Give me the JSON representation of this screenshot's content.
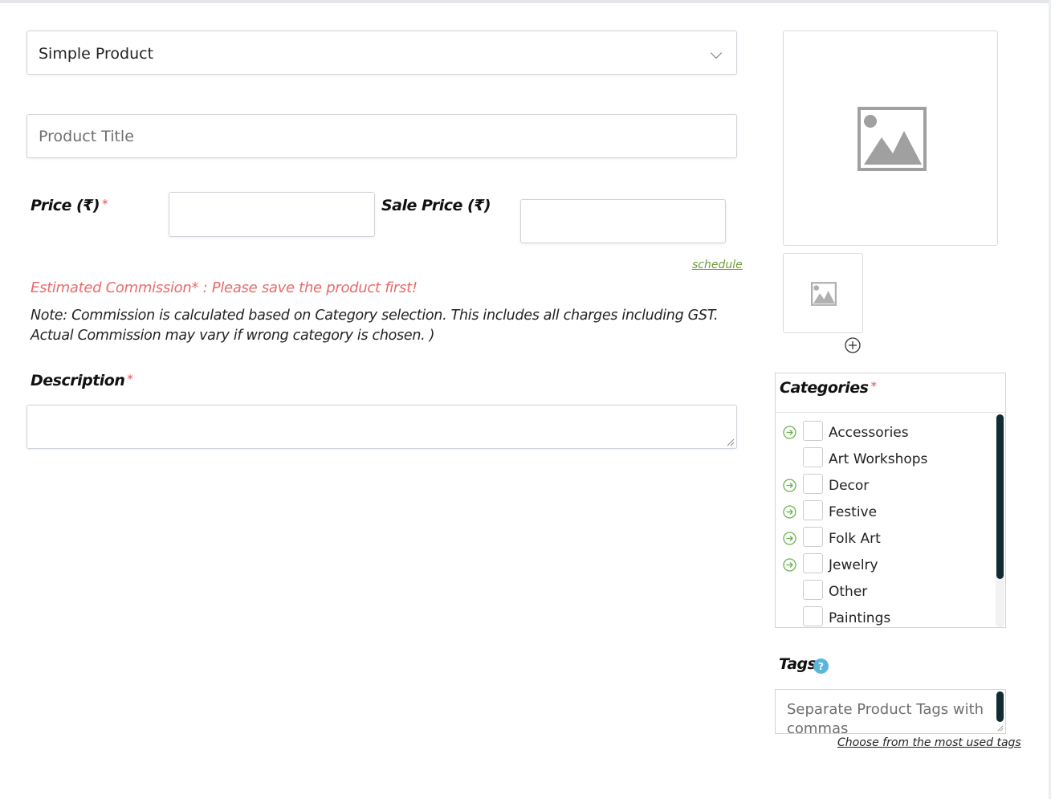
{
  "product_type": {
    "selected": "Simple Product"
  },
  "title": {
    "placeholder": "Product Title"
  },
  "price": {
    "label": "Price (₹)",
    "required_mark": "*"
  },
  "sale_price": {
    "label": "Sale Price (₹)",
    "schedule_link": "schedule"
  },
  "commission": {
    "estimate_text": "Estimated Commission* : Please save the product first!",
    "note": "Note: Commission is calculated based on Category selection. This includes all charges including GST. Actual Commission may vary if wrong category is chosen. )"
  },
  "description": {
    "label": "Description",
    "required_mark": "*"
  },
  "categories": {
    "label": "Categories",
    "required_mark": "*",
    "items": [
      {
        "name": "Accessories",
        "has_children": true
      },
      {
        "name": "Art Workshops",
        "has_children": false
      },
      {
        "name": "Decor",
        "has_children": true
      },
      {
        "name": "Festive",
        "has_children": true
      },
      {
        "name": "Folk Art",
        "has_children": true
      },
      {
        "name": "Jewelry",
        "has_children": true
      },
      {
        "name": "Other",
        "has_children": false
      },
      {
        "name": "Paintings",
        "has_children": false
      }
    ]
  },
  "tags": {
    "label": "Tags",
    "placeholder": "Separate Product Tags with commas",
    "most_used_link": "Choose from the most used tags"
  },
  "colors": {
    "required": "#e2554f",
    "commission_text": "#e96b6b",
    "schedule_link": "#6b9e3a",
    "expand_arrow": "#6ab04c",
    "help_icon": "#5bb5dd",
    "scrollbar": "#112b32"
  }
}
